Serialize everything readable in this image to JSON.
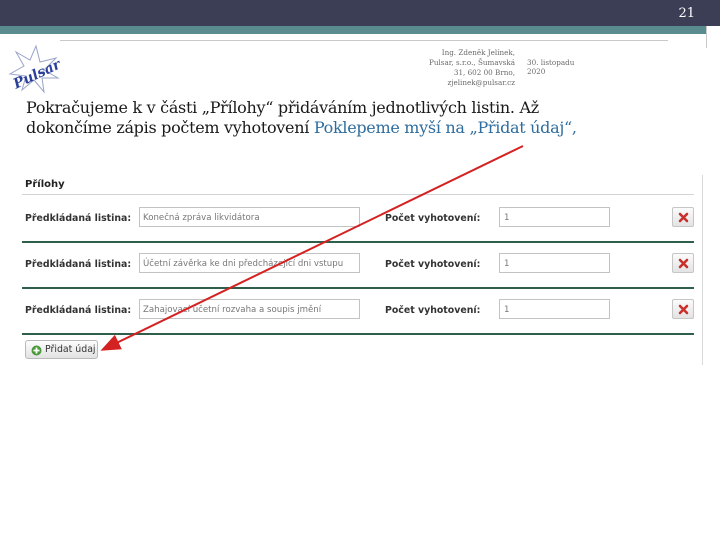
{
  "slide": {
    "number": "21"
  },
  "author": {
    "text": "Ing. Zdeněk Jelínek,\nPulsar, s.r.o., Šumavská\n31, 602 00  Brno,\nzjelinek@pulsar.cz"
  },
  "date": {
    "text": "30. listopadu\n2020"
  },
  "logo": {
    "text": "Pulsar",
    "color": "#2a3f9a"
  },
  "body": {
    "text": "Pokračujeme k v části „Přílohy“ přidáváním jednotlivých listin. Až dokončíme zápis počtem vyhotovení ",
    "highlight": "Poklepeme myší na „Přidat údaj“,"
  },
  "form": {
    "title": "Přílohy",
    "doc_label": "Předkládaná listina:",
    "count_label": "Počet vyhotovení:",
    "rows": [
      {
        "document": "Konečná zpráva likvidátora",
        "count": "1"
      },
      {
        "document": "Účetní závěrka ke dni předcházející dni vstupu",
        "count": "1"
      },
      {
        "document": "Zahajovací účetní rozvaha a soupis jmění",
        "count": "1"
      }
    ],
    "add_label": "Přidat údaj"
  },
  "colors": {
    "arrow": "#d42222",
    "header": "#3c3e56",
    "teal": "#5a8c8f",
    "separator": "#2f5f4a"
  },
  "icons": {
    "delete": "delete-x-icon",
    "add": "plus-circle-icon"
  }
}
